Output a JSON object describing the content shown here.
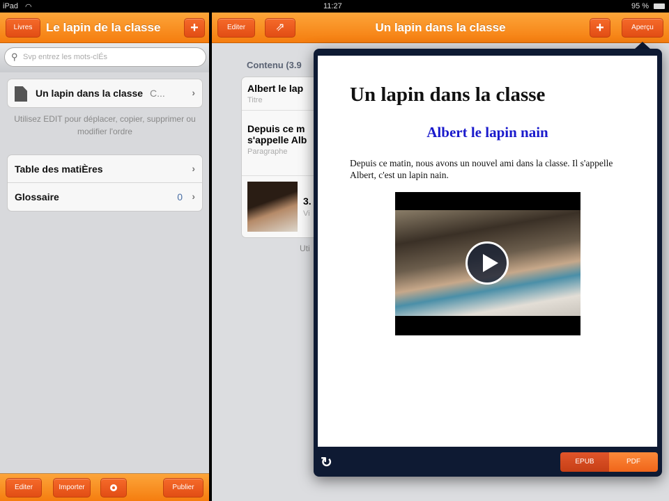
{
  "status": {
    "device": "iPad",
    "time": "11:27",
    "battery": "95 %"
  },
  "left": {
    "back_label": "Livres",
    "title": "Le lapin de la classe",
    "add_label": "+",
    "search_placeholder": "Svp entrez les mots-clÉs",
    "book": {
      "title": "Un lapin dans la classe",
      "suffix": "C..."
    },
    "hint": "Utilisez EDIT pour déplacer, copier, supprimer ou modifier l'ordre",
    "items": [
      {
        "label": "Table des matiÈres",
        "count": ""
      },
      {
        "label": "Glossaire",
        "count": "0"
      }
    ],
    "toolbar": {
      "edit": "Editer",
      "import": "Importer",
      "publish": "Publier"
    }
  },
  "right": {
    "edit_label": "Editer",
    "title": "Un lapin dans la classe",
    "add_label": "+",
    "preview_label": "Aperçu",
    "section": "Contenu (3.9",
    "items": [
      {
        "title": "Albert le lap",
        "type": "Titre"
      },
      {
        "title": "Depuis ce m",
        "title2": "s'appelle Alb",
        "type": "Paragraphe"
      },
      {
        "title": "3.",
        "type": "Vi"
      }
    ],
    "footer": "Uti"
  },
  "preview": {
    "title": "Un lapin dans la classe",
    "heading": "Albert le lapin nain",
    "paragraph": "Depuis ce matin, nous avons un nouvel ami dans la classe. Il s'appelle Albert, c'est un lapin nain.",
    "epub": "EPUB",
    "pdf": "PDF",
    "heading_color": "#1a1acc"
  }
}
